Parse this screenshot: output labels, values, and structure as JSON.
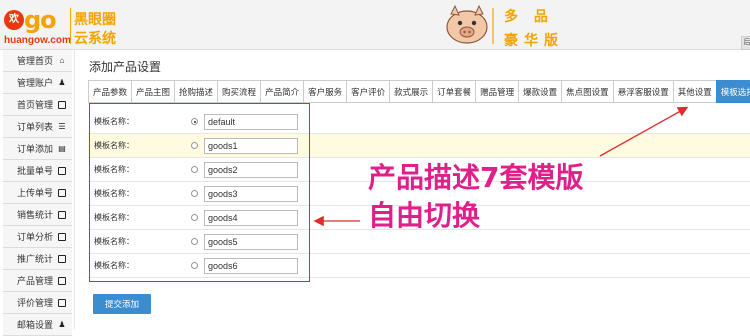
{
  "header": {
    "logo_circle": "欢",
    "logo_go": "go",
    "logo_domain": "huangow.com",
    "logo_brand1": "黑眼圈",
    "logo_brand2": "云系统",
    "edition_line1": "多 品",
    "edition_line2": "豪华版",
    "corner_button": "后"
  },
  "sidebar": {
    "items": [
      {
        "label": "管理首页",
        "icon": "home-icon",
        "glyph": "⌂"
      },
      {
        "label": "管理账户",
        "icon": "user-icon",
        "glyph": "♟"
      },
      {
        "label": "首页管理",
        "icon": "window-icon",
        "glyph": ""
      },
      {
        "label": "订单列表",
        "icon": "list-icon",
        "glyph": "☰"
      },
      {
        "label": "订单添加",
        "icon": "file-icon",
        "glyph": "▤"
      },
      {
        "label": "批量单号",
        "icon": "window-icon",
        "glyph": ""
      },
      {
        "label": "上传单号",
        "icon": "window-icon",
        "glyph": ""
      },
      {
        "label": "销售统计",
        "icon": "window-icon",
        "glyph": ""
      },
      {
        "label": "订单分析",
        "icon": "window-icon",
        "glyph": ""
      },
      {
        "label": "推广统计",
        "icon": "window-icon",
        "glyph": ""
      },
      {
        "label": "产品管理",
        "icon": "window-icon",
        "glyph": ""
      },
      {
        "label": "评价管理",
        "icon": "window-icon",
        "glyph": ""
      },
      {
        "label": "邮箱设置",
        "icon": "user-icon",
        "glyph": "♟"
      }
    ]
  },
  "main": {
    "title": "添加产品设置",
    "tabs": [
      "产品参数",
      "产品主图",
      "抢购描述",
      "购买流程",
      "产品简介",
      "客户服务",
      "客户评价",
      "款式展示",
      "订单套餐",
      "赠品管理",
      "爆款设置",
      "焦点图设置",
      "悬浮客服设置",
      "其他设置",
      "模板选择"
    ],
    "active_tab": "模板选择",
    "rows": [
      {
        "label": "模板名称：",
        "value": "default",
        "checked": true
      },
      {
        "label": "模板名称：",
        "value": "goods1",
        "checked": false
      },
      {
        "label": "模板名称：",
        "value": "goods2",
        "checked": false
      },
      {
        "label": "模板名称：",
        "value": "goods3",
        "checked": false
      },
      {
        "label": "模板名称：",
        "value": "goods4",
        "checked": false
      },
      {
        "label": "模板名称：",
        "value": "goods5",
        "checked": false
      },
      {
        "label": "模板名称：",
        "value": "goods6",
        "checked": false
      }
    ],
    "submit_label": "提交添加"
  },
  "annotation": {
    "line1": "产品描述7套模版",
    "line2": "自由切换",
    "color": "#e0208a",
    "box_color": "#e02b2b"
  }
}
